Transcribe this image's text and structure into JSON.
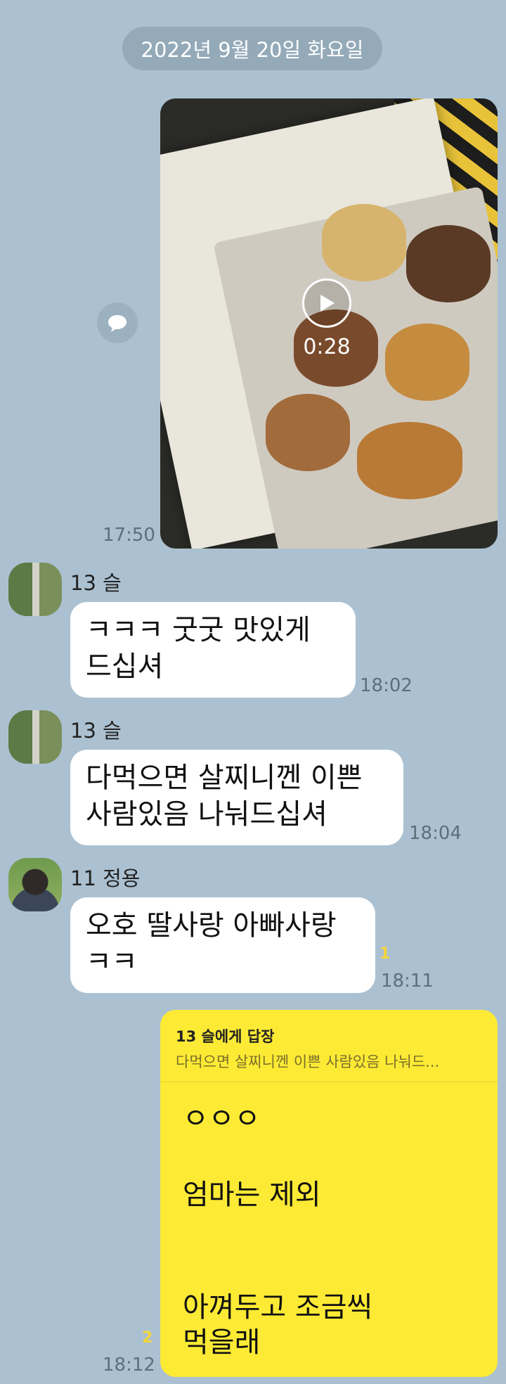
{
  "date_divider": "2022년 9월 20일 화요일",
  "video_message": {
    "duration": "0:28",
    "time": "17:50"
  },
  "messages": [
    {
      "sender": "13 슬",
      "text": "ㅋㅋㅋ  굿굿 맛있게\n드십셔",
      "time": "18:02"
    },
    {
      "sender": "13 슬",
      "text": "다먹으면 살찌니껜 이쁜\n사람있음 나눠드십셔",
      "time": "18:04"
    },
    {
      "sender": "11 정용",
      "text": "오호 딸사랑 아빠사랑\nㅋㅋ",
      "time": "18:11",
      "unread": "1"
    }
  ],
  "my_reply": {
    "reply_to": "13 슬에게 답장",
    "quoted": "다먹으면 살찌니껜 이쁜 사람있음 나눠드...",
    "lines": [
      "ㅇㅇㅇ",
      "엄마는 제외",
      "아껴두고 조금씩",
      "먹을래"
    ],
    "time": "18:12",
    "unread": "2"
  }
}
